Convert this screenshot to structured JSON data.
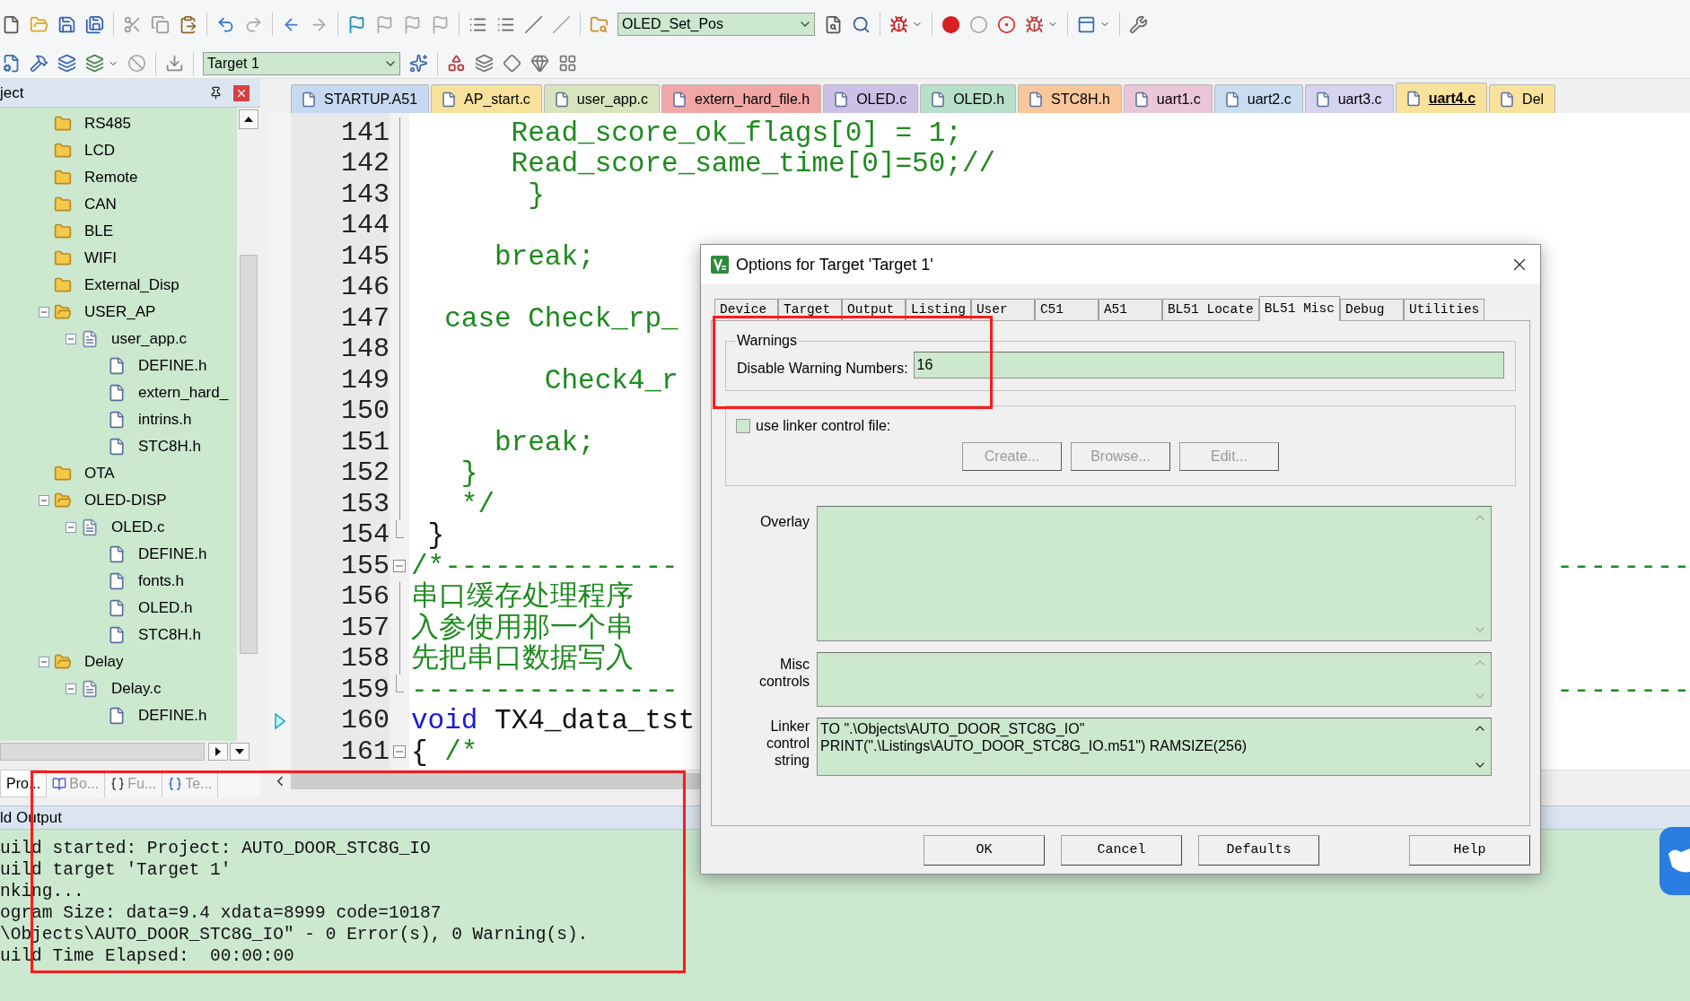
{
  "toolbar": {
    "function_combo": "OLED_Set_Pos",
    "target_combo": "Target 1"
  },
  "project_panel": {
    "title": "ject",
    "tree": [
      {
        "label": "RS485",
        "kind": "folder"
      },
      {
        "label": "LCD",
        "kind": "folder"
      },
      {
        "label": "Remote",
        "kind": "folder"
      },
      {
        "label": "CAN",
        "kind": "folder"
      },
      {
        "label": "BLE",
        "kind": "folder"
      },
      {
        "label": "WIFI",
        "kind": "folder"
      },
      {
        "label": "External_Disp",
        "kind": "folder"
      },
      {
        "label": "USER_AP",
        "kind": "folder",
        "expanded": true,
        "children": [
          {
            "label": "user_app.c",
            "kind": "source",
            "expanded": true,
            "children": [
              {
                "label": "DEFINE.h",
                "kind": "header"
              },
              {
                "label": "extern_hard_",
                "kind": "header"
              },
              {
                "label": "intrins.h",
                "kind": "header"
              },
              {
                "label": "STC8H.h",
                "kind": "header"
              }
            ]
          }
        ]
      },
      {
        "label": "OTA",
        "kind": "folder"
      },
      {
        "label": "OLED-DISP",
        "kind": "folder",
        "expanded": true,
        "children": [
          {
            "label": "OLED.c",
            "kind": "source",
            "expanded": true,
            "children": [
              {
                "label": "DEFINE.h",
                "kind": "header"
              },
              {
                "label": "fonts.h",
                "kind": "header"
              },
              {
                "label": "OLED.h",
                "kind": "header"
              },
              {
                "label": "STC8H.h",
                "kind": "header"
              }
            ]
          }
        ]
      },
      {
        "label": "Delay",
        "kind": "folder",
        "expanded": true,
        "children": [
          {
            "label": "Delay.c",
            "kind": "source",
            "expanded": true,
            "children": [
              {
                "label": "DEFINE.h",
                "kind": "header"
              }
            ]
          }
        ]
      }
    ],
    "tabs": [
      {
        "label": "Pro...",
        "kind": "project",
        "selected": true
      },
      {
        "label": "Bo...",
        "kind": "books",
        "selected": false
      },
      {
        "label": "Fu...",
        "kind": "functions",
        "selected": false
      },
      {
        "label": "Te...",
        "kind": "templates",
        "selected": false
      }
    ]
  },
  "editor": {
    "tabs": [
      {
        "label": "STARTUP.A51",
        "color": "#c6d9f1",
        "selected": false
      },
      {
        "label": "AP_start.c",
        "color": "#f9e29c",
        "selected": false
      },
      {
        "label": "user_app.c",
        "color": "#d7e4bd",
        "selected": false
      },
      {
        "label": "extern_hard_file.h",
        "color": "#f2a7a7",
        "selected": false
      },
      {
        "label": "OLED.c",
        "color": "#ccc0e6",
        "selected": false
      },
      {
        "label": "OLED.h",
        "color": "#b7dfc9",
        "selected": false
      },
      {
        "label": "STC8H.h",
        "color": "#f9c79b",
        "selected": false
      },
      {
        "label": "uart1.c",
        "color": "#ebc6d7",
        "selected": false
      },
      {
        "label": "uart2.c",
        "color": "#c9dcf2",
        "selected": false
      },
      {
        "label": "uart3.c",
        "color": "#d5d3ef",
        "selected": false
      },
      {
        "label": "uart4.c",
        "color": "#f9e29c",
        "selected": true
      },
      {
        "label": "Del",
        "color": "#f9e29c",
        "selected": false
      }
    ],
    "lines": [
      {
        "number": "141",
        "current": false,
        "kind": "foldbody",
        "segments": [
          {
            "text": "      Read_score_ok_flags[0] = 1;",
            "kind": "comment"
          }
        ]
      },
      {
        "number": "142",
        "current": false,
        "kind": "foldbody",
        "segments": [
          {
            "text": "      Read_score_same_time[0]=50;//",
            "kind": "comment"
          }
        ]
      },
      {
        "number": "143",
        "current": false,
        "kind": "foldbody",
        "segments": [
          {
            "text": "       }",
            "kind": "comment"
          }
        ]
      },
      {
        "number": "144",
        "current": false,
        "kind": "foldbody"
      },
      {
        "number": "145",
        "current": false,
        "kind": "foldbody",
        "segments": [
          {
            "text": "     break;",
            "kind": "comment"
          }
        ]
      },
      {
        "number": "146",
        "current": false,
        "kind": "foldbody"
      },
      {
        "number": "147",
        "current": false,
        "kind": "foldbody",
        "segments": [
          {
            "text": "  case Check_rp_",
            "kind": "comment"
          }
        ]
      },
      {
        "number": "148",
        "current": false,
        "kind": "foldbody"
      },
      {
        "number": "149",
        "current": false,
        "kind": "foldbody",
        "segments": [
          {
            "text": "        Check4_r",
            "kind": "comment"
          }
        ]
      },
      {
        "number": "150",
        "current": false,
        "kind": "foldbody"
      },
      {
        "number": "151",
        "current": false,
        "kind": "foldbody",
        "segments": [
          {
            "text": "     break;",
            "kind": "comment"
          }
        ]
      },
      {
        "number": "152",
        "current": false,
        "kind": "foldbody",
        "segments": [
          {
            "text": "   }",
            "kind": "comment"
          }
        ]
      },
      {
        "number": "153",
        "current": false,
        "kind": "foldbody",
        "segments": [
          {
            "text": "   */",
            "kind": "comment"
          }
        ]
      },
      {
        "number": "154",
        "current": false,
        "kind": "foldend",
        "segments": [
          {
            "text": " }",
            "kind": "plain"
          }
        ]
      },
      {
        "number": "155",
        "current": false,
        "kind": "foldstart",
        "segments": [
          {
            "text": "/*--------------",
            "kind": "comment"
          }
        ],
        "tail": "--------"
      },
      {
        "number": "156",
        "current": false,
        "kind": "foldbody",
        "segments": [
          {
            "text": "串口缓存处理程序",
            "kind": "comment"
          }
        ]
      },
      {
        "number": "157",
        "current": false,
        "kind": "foldbody",
        "segments": [
          {
            "text": "入参使用那一个串",
            "kind": "comment"
          }
        ]
      },
      {
        "number": "158",
        "current": false,
        "kind": "foldbody",
        "segments": [
          {
            "text": "先把串口数据写入",
            "kind": "comment"
          }
        ]
      },
      {
        "number": "159",
        "current": false,
        "kind": "foldend",
        "segments": [
          {
            "text": "----------------",
            "kind": "comment"
          }
        ],
        "tail": "--------"
      },
      {
        "number": "160",
        "current": true,
        "kind": "plain",
        "segments": [
          {
            "text": "void",
            "kind": "keyword"
          },
          {
            "text": " TX4_data_tst",
            "kind": "plain"
          }
        ]
      },
      {
        "number": "161",
        "current": false,
        "kind": "foldstart",
        "segments": [
          {
            "text": "{ ",
            "kind": "plain"
          },
          {
            "text": "/*",
            "kind": "comment"
          }
        ]
      }
    ]
  },
  "dialog": {
    "title": "Options for Target 'Target 1'",
    "tabs": [
      {
        "label": "Device",
        "selected": false
      },
      {
        "label": "Target",
        "selected": false
      },
      {
        "label": "Output",
        "selected": false
      },
      {
        "label": "Listing",
        "selected": false
      },
      {
        "label": "User",
        "selected": false
      },
      {
        "label": "C51",
        "selected": false
      },
      {
        "label": "A51",
        "selected": false
      },
      {
        "label": "BL51 Locate",
        "selected": false
      },
      {
        "label": "BL51 Misc",
        "selected": true
      },
      {
        "label": "Debug",
        "selected": false
      },
      {
        "label": "Utilities",
        "selected": false
      }
    ],
    "warnings": {
      "group_label": "Warnings",
      "field_label": "Disable Warning Numbers:",
      "value": "16"
    },
    "linker_file": {
      "checkbox_label": "use linker control file:",
      "checked": false,
      "buttons": [
        {
          "label": "Create...",
          "disabled": true
        },
        {
          "label": "Browse...",
          "disabled": true
        },
        {
          "label": "Edit...",
          "disabled": true
        }
      ]
    },
    "overlay": {
      "label": "Overlay"
    },
    "misc_controls": {
      "label": "Misc controls"
    },
    "linker_control_string": {
      "label": "Linker control string",
      "value": [
        "TO \".\\Objects\\AUTO_DOOR_STC8G_IO\"",
        "PRINT(\".\\Listings\\AUTO_DOOR_STC8G_IO.m51\") RAMSIZE(256)"
      ]
    },
    "buttons": [
      "OK",
      "Cancel",
      "Defaults",
      "Help"
    ]
  },
  "build_output": {
    "title": "ld Output",
    "lines": [
      "uild started: Project: AUTO_DOOR_STC8G_IO",
      "uild target 'Target 1'",
      "nking...",
      "ogram Size: data=9.4 xdata=8999 code=10187",
      "\\Objects\\AUTO_DOOR_STC8G_IO\" - 0 Error(s), 0 Warning(s).",
      "uild Time Elapsed:  00:00:00"
    ]
  }
}
